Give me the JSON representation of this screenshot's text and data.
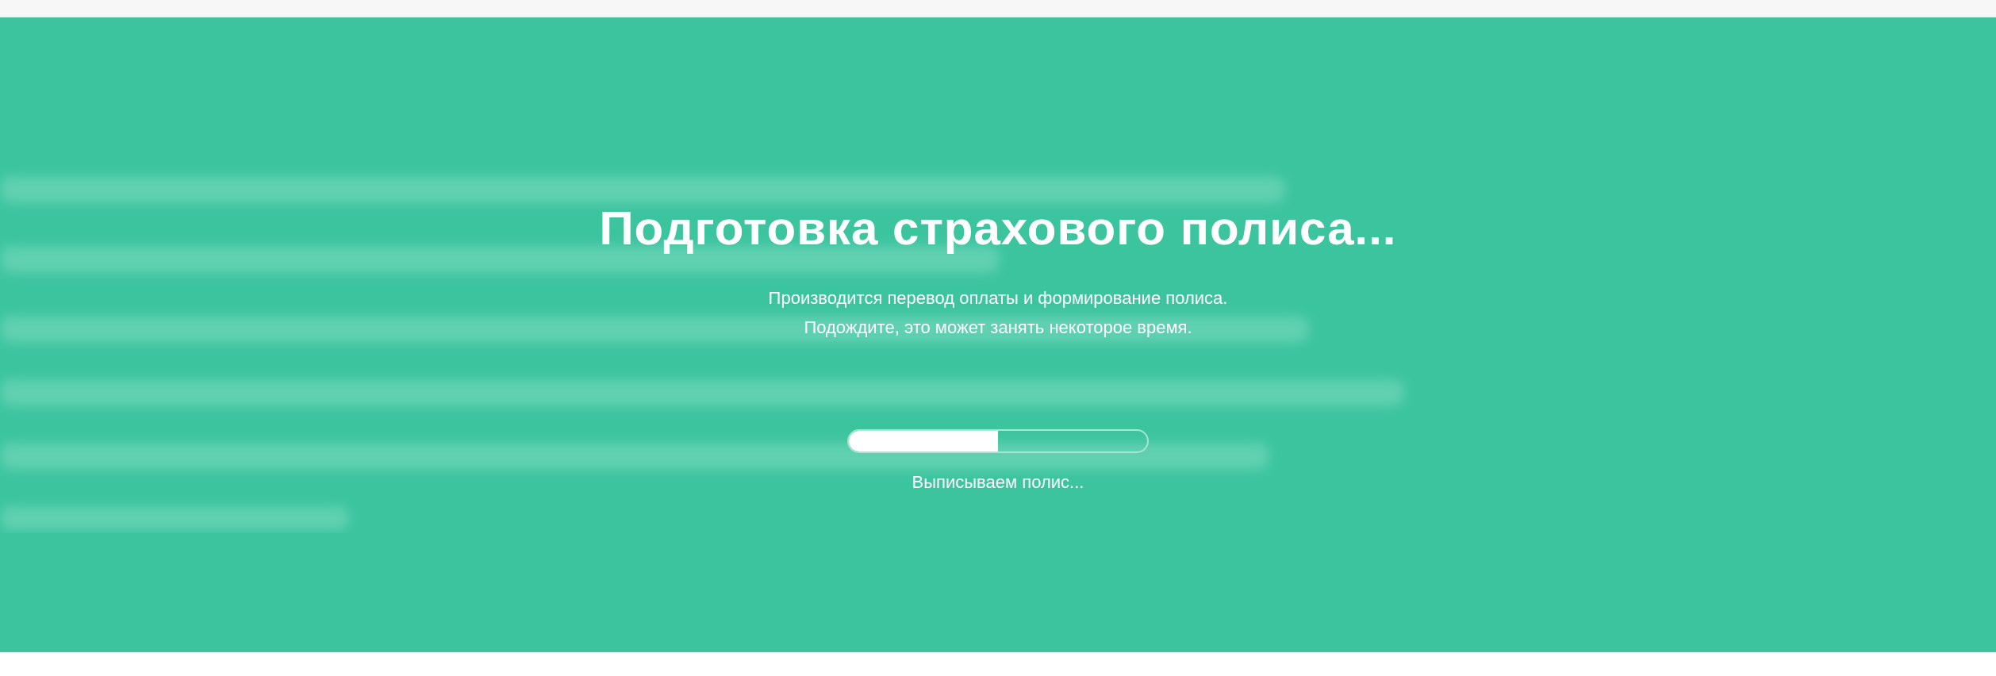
{
  "loader": {
    "title": "Подготовка страхового полиса...",
    "message_lines": [
      "Производится перевод оплаты и формирование полиса.",
      "Подождите, это может занять некоторое время."
    ],
    "progress": {
      "level": 0.5,
      "caption": "Выписываем полис..."
    }
  }
}
